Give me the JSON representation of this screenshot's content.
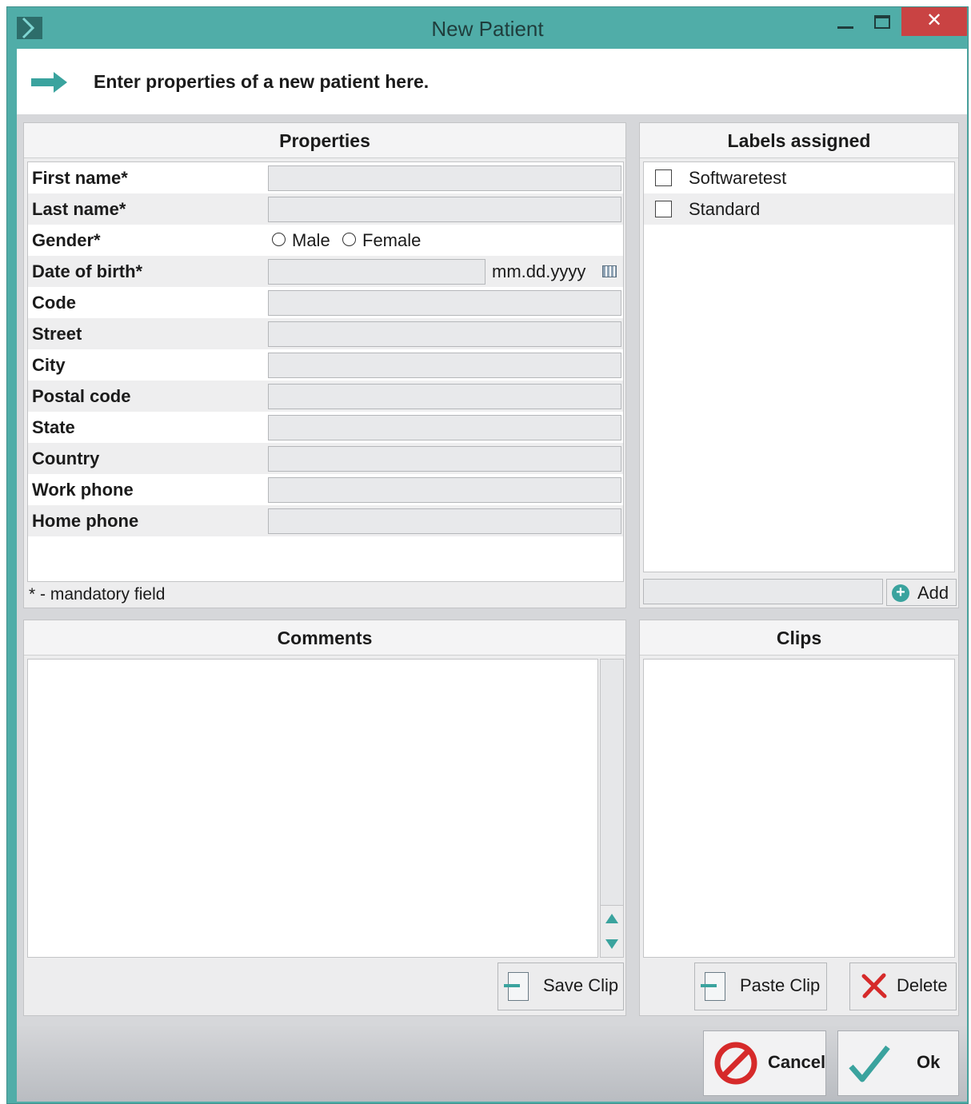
{
  "window": {
    "title": "New Patient",
    "close_glyph": "✕"
  },
  "header": {
    "text": "Enter properties of a new patient here.",
    "icon": "arrow-right-icon"
  },
  "properties": {
    "title": "Properties",
    "fields": {
      "first_name": "First name*",
      "last_name": "Last name*",
      "gender": "Gender*",
      "date_of_birth": "Date of birth*",
      "code": "Code",
      "street": "Street",
      "city": "City",
      "postal_code": "Postal code",
      "state": "State",
      "country": "Country",
      "work_phone": "Work phone",
      "home_phone": "Home phone"
    },
    "gender_options": {
      "male": "Male",
      "female": "Female"
    },
    "dob_format": "mm.dd.yyyy",
    "mandatory_note": "* - mandatory field"
  },
  "labels": {
    "title": "Labels assigned",
    "items": [
      {
        "label": "Softwaretest",
        "checked": false
      },
      {
        "label": "Standard",
        "checked": false
      }
    ],
    "add_label": "Add"
  },
  "comments": {
    "title": "Comments",
    "save_clip_label": "Save Clip"
  },
  "clips": {
    "title": "Clips",
    "paste_clip_label": "Paste Clip",
    "delete_label": "Delete"
  },
  "footer": {
    "cancel_label": "Cancel",
    "ok_label": "Ok"
  },
  "colors": {
    "accent": "#50ada8",
    "close_button": "#c94343",
    "icon_teal": "#3aa39e",
    "cancel_red": "#d62a2a"
  }
}
